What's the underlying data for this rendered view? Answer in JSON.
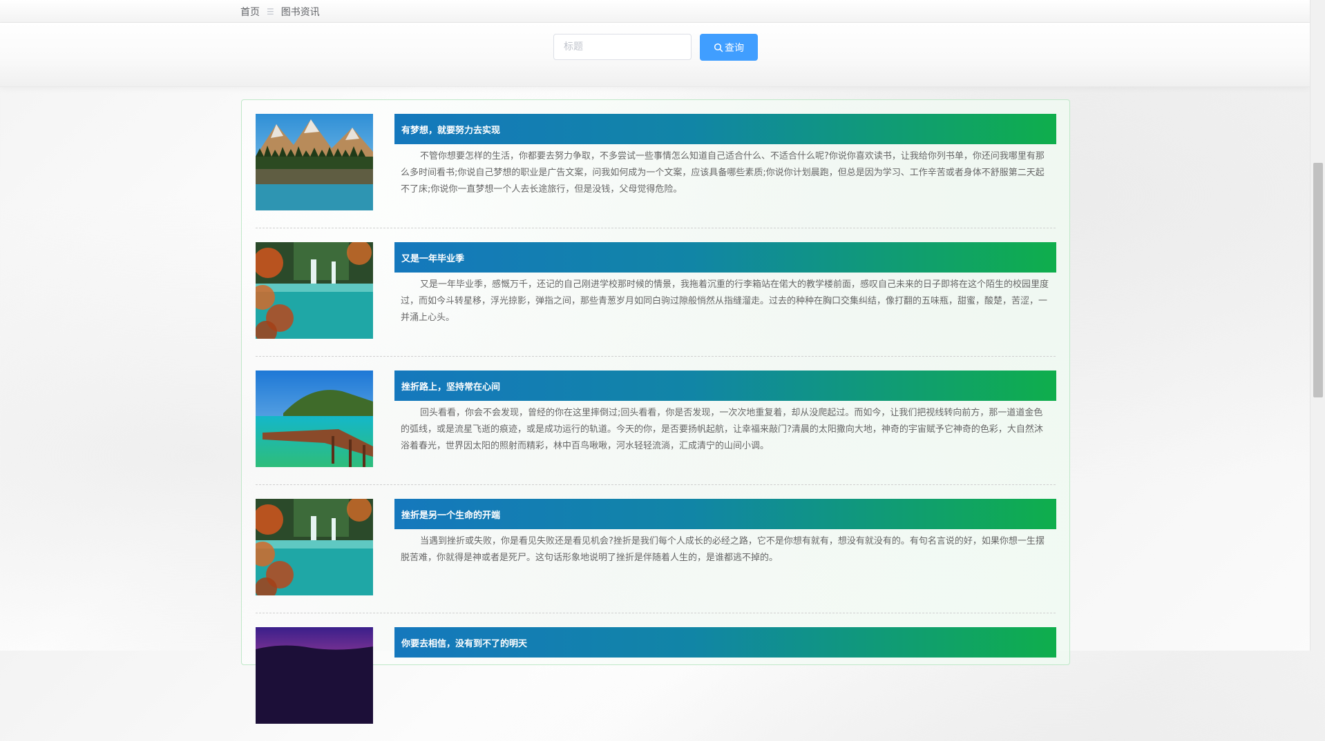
{
  "breadcrumb": {
    "home": "首页",
    "separator": "☰",
    "current": "图书资讯"
  },
  "search": {
    "placeholder": "标题",
    "value": "",
    "button_label": "查询"
  },
  "colors": {
    "primary_button": "#409eff",
    "title_gradient_start": "#1578bd",
    "title_gradient_end": "#0fae4c",
    "panel_border": "#bfe8c8"
  },
  "articles": [
    {
      "title": "有梦想，就要努力去实现",
      "excerpt": "不管你想要怎样的生活，你都要去努力争取，不多尝试一些事情怎么知道自己适合什么、不适合什么呢?你说你喜欢读书，让我给你列书单，你还问我哪里有那么多时间看书;你说自己梦想的职业是广告文案，问我如何成为一个文案，应该具备哪些素质;你说你计划晨跑，但总是因为学习、工作辛苦或者身体不舒服第二天起不了床;你说你一直梦想一个人去长途旅行，但是没钱，父母觉得危险。",
      "thumbnail": "mountain-lake"
    },
    {
      "title": "又是一年毕业季",
      "excerpt": "又是一年毕业季，感慨万千，还记的自己刚进学校那时候的情景，我拖着沉重的行李箱站在偌大的教学楼前面，感叹自己未来的日子即将在这个陌生的校园里度过，而如今斗转星移，浮光掠影，弹指之间，那些青葱岁月如同白驹过隙般悄然从指缝溜走。过去的种种在胸口交集纠结，像打翻的五味瓶，甜蜜，酸楚，苦涩，一并涌上心头。",
      "thumbnail": "waterfall-autumn"
    },
    {
      "title": "挫折路上，坚持常在心间",
      "excerpt": "回头看看，你会不会发现，曾经的你在这里摔倒过;回头看看，你是否发现，一次次地重复着，却从没爬起过。而如今，让我们把视线转向前方，那一道道金色的弧线，或是流星飞逝的痕迹，或是成功运行的轨道。今天的你，是否要扬帆起航，让幸福来敲门?清晨的太阳撒向大地，神奇的宇宙赋予它神奇的色彩，大自然沐浴着春光，世界因太阳的照射而精彩，林中百鸟啾啾，河水轻轻流淌，汇成清宁的山间小调。",
      "thumbnail": "pier-sea"
    },
    {
      "title": "挫折是另一个生命的开端",
      "excerpt": "当遇到挫折或失败，你是看见失败还是看见机会?挫折是我们每个人成长的必经之路，它不是你想有就有，想没有就没有的。有句名言说的好，如果你想一生摆脱苦难，你就得是神或者是死尸。这句话形象地说明了挫折是伴随着人生的，是谁都逃不掉的。",
      "thumbnail": "waterfall-autumn"
    },
    {
      "title": "你要去相信，没有到不了的明天",
      "excerpt": "",
      "thumbnail": "purple-sky"
    }
  ]
}
